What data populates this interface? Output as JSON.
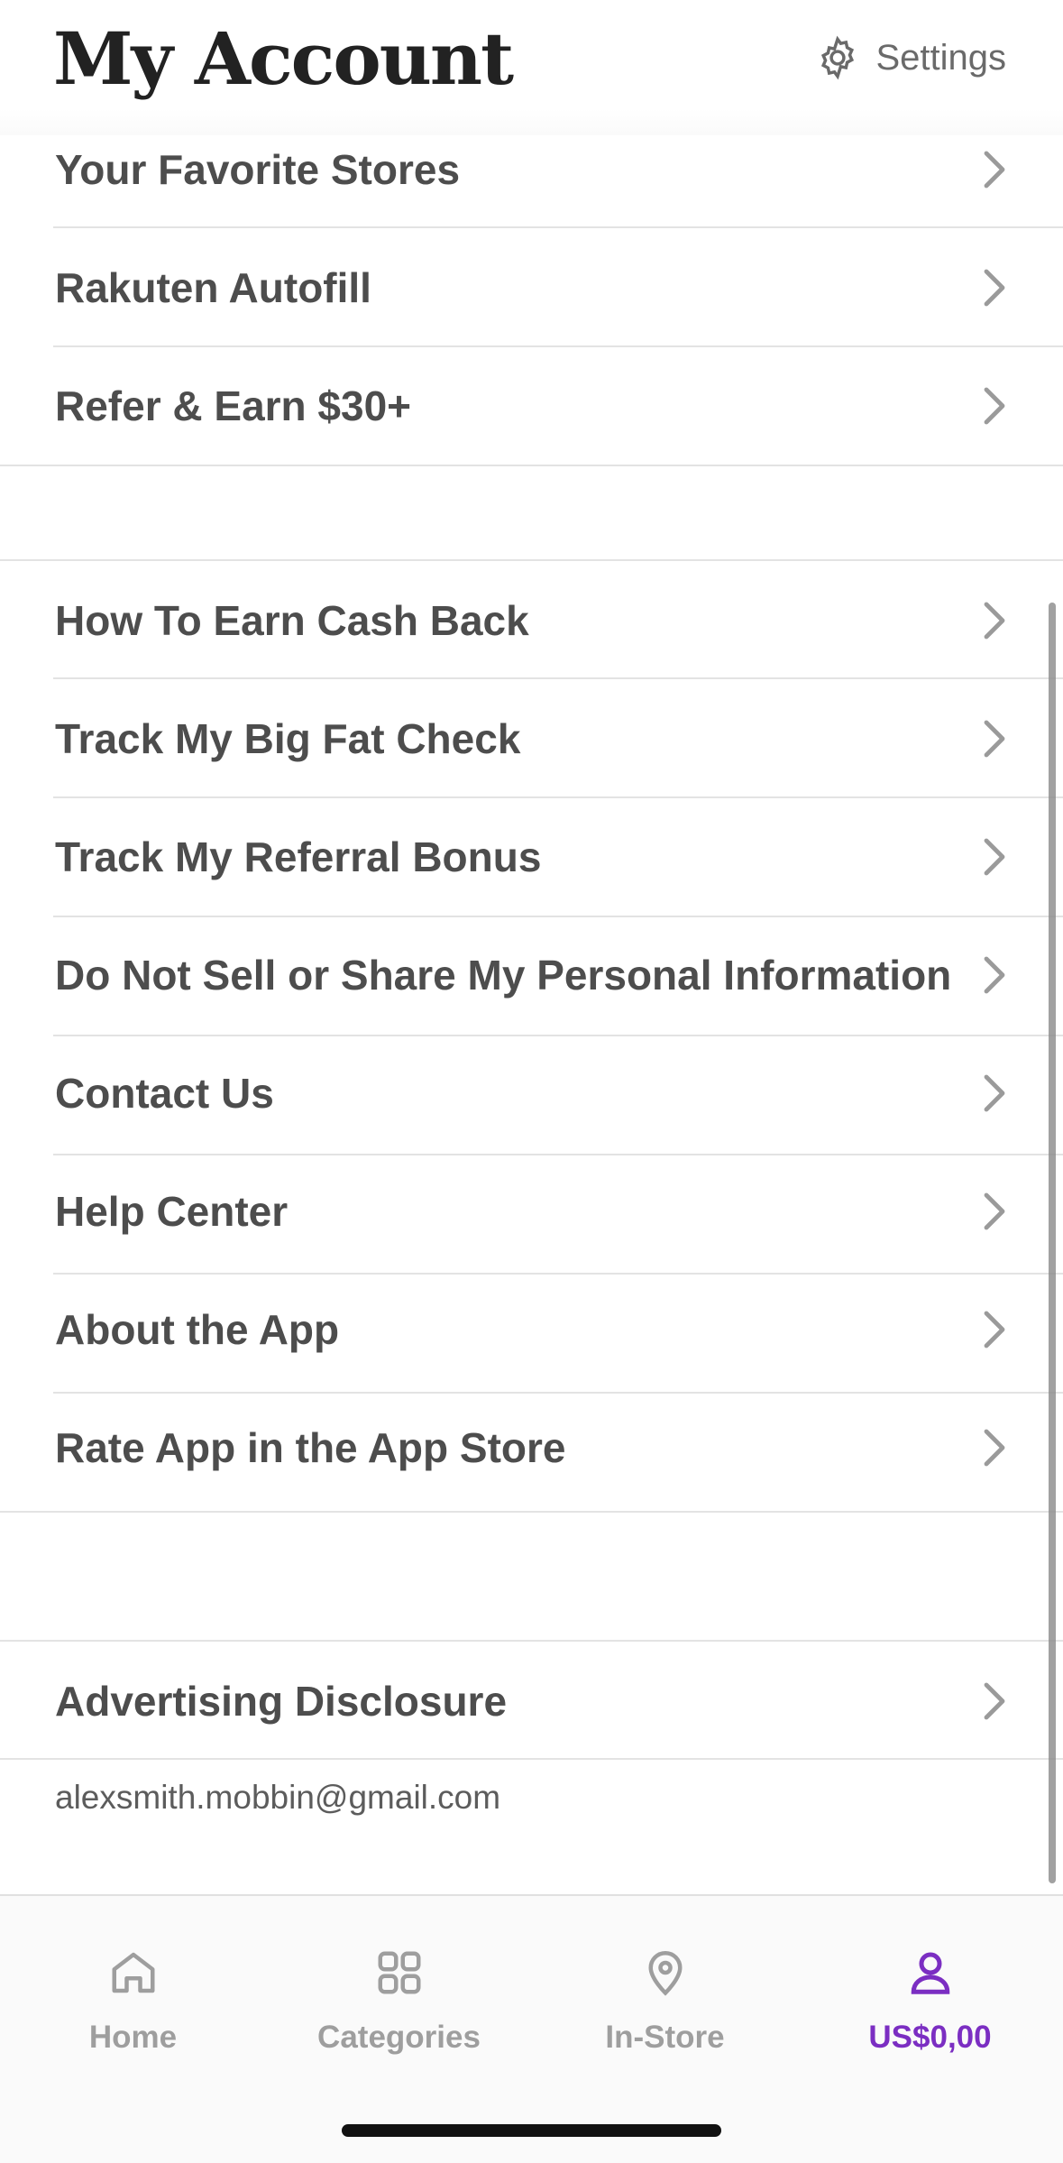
{
  "header": {
    "title": "My Account",
    "settings_label": "Settings",
    "settings_icon": "gear-icon"
  },
  "section1": {
    "items": [
      {
        "label": "Your Favorite Stores"
      },
      {
        "label": "Rakuten Autofill"
      },
      {
        "label": "Refer & Earn $30+"
      }
    ]
  },
  "section2": {
    "items": [
      {
        "label": "How To Earn Cash Back"
      },
      {
        "label": "Track My Big Fat Check"
      },
      {
        "label": "Track My Referral Bonus"
      },
      {
        "label": "Do Not Sell or Share My Personal Information"
      },
      {
        "label": "Contact Us"
      },
      {
        "label": "Help Center"
      },
      {
        "label": "About the App"
      },
      {
        "label": "Rate App in the App Store"
      }
    ]
  },
  "section3": {
    "items": [
      {
        "label": "Advertising Disclosure"
      }
    ]
  },
  "account": {
    "email": "alexsmith.mobbin@gmail.com"
  },
  "tabbar": {
    "tabs": [
      {
        "label": "Home",
        "icon": "home-icon",
        "active": false
      },
      {
        "label": "Categories",
        "icon": "grid-icon",
        "active": false
      },
      {
        "label": "In-Store",
        "icon": "location-pin-icon",
        "active": false
      },
      {
        "label": "US$0,00",
        "icon": "person-icon",
        "active": true
      }
    ]
  },
  "colors": {
    "accent": "#7b2ec2",
    "text": "#4d4d4d",
    "inactive_tab": "#9e9e9e"
  }
}
